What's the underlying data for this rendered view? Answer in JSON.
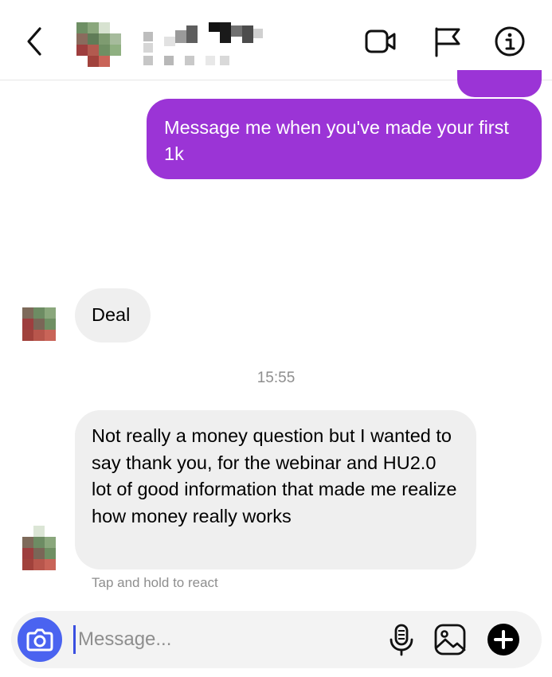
{
  "header": {
    "contact_name_redacted": true,
    "icons": [
      "back-icon",
      "video-call-icon",
      "flag-icon",
      "info-icon"
    ]
  },
  "messages": {
    "sent_1": "Message me when you've made your first 1k",
    "sent_emoji": "💪",
    "received_1": "Deal",
    "timestamp": "15:55",
    "received_2": "Not really a money question but I wanted to say thank you, for the webinar and  HU2.0 lot of good information that made me realize how money really works",
    "react_hint": "Tap and hold to react"
  },
  "composer": {
    "placeholder": "Message...",
    "value": "",
    "icons": [
      "camera-icon",
      "microphone-icon",
      "image-icon",
      "plus-icon"
    ]
  },
  "colors": {
    "outgoing_bubble": "#9b34d6",
    "incoming_bubble": "#efefef",
    "camera_button": "#4a63f0",
    "muted_text": "#8e8e8e"
  }
}
